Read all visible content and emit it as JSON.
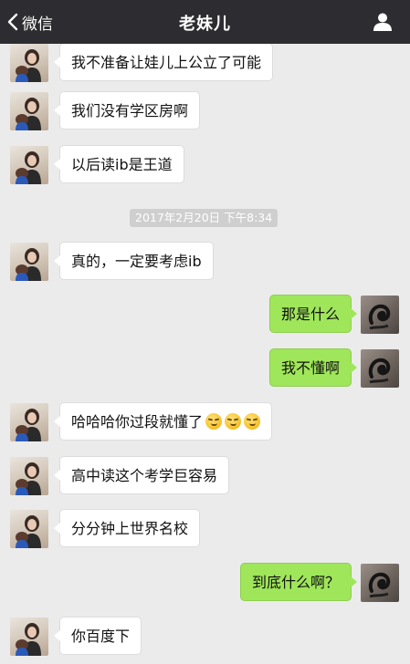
{
  "header": {
    "back_label": "微信",
    "title": "老妹儿"
  },
  "messages": [
    {
      "side": "left",
      "text": "我不准备让娃儿上公立了可能"
    },
    {
      "side": "left",
      "text": "我们没有学区房啊"
    },
    {
      "side": "left",
      "text": "以后读ib是王道"
    },
    {
      "side": "left",
      "text": "真的，一定要考虑ib"
    },
    {
      "side": "right",
      "text": "那是什么"
    },
    {
      "side": "right",
      "text": "我不懂啊"
    },
    {
      "side": "left",
      "text": "哈哈哈你过段就懂了",
      "emoji": "smirk-emoji",
      "emoji_count": 3
    },
    {
      "side": "left",
      "text": "高中读这个考学巨容易"
    },
    {
      "side": "left",
      "text": "分分钟上世界名校"
    },
    {
      "side": "right",
      "text": "到底什么啊？"
    },
    {
      "side": "left",
      "text": "你百度下"
    }
  ],
  "timestamp": "2017年2月20日  下午8:34",
  "colors": {
    "header_bg": "#2d2d31",
    "chat_bg": "#ebebeb",
    "bubble_self": "#9fe65a",
    "bubble_other": "#ffffff"
  }
}
